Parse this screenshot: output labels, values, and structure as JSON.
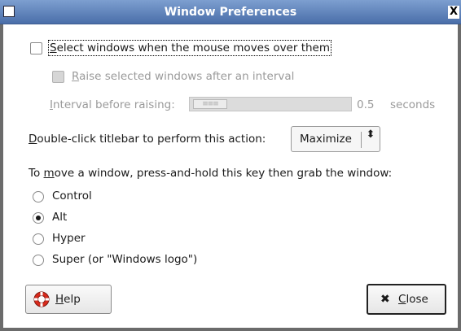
{
  "window": {
    "title": "Window Preferences",
    "close_glyph": "X"
  },
  "focus_option": {
    "label": "Select windows when the mouse moves over them",
    "checked": false
  },
  "raise_option": {
    "label": "Raise selected windows after an interval",
    "checked": false,
    "enabled": false
  },
  "interval": {
    "label": "Interval before raising:",
    "value": "0.5",
    "unit": "seconds",
    "thumb_glyph": "≡≡≡",
    "enabled": false
  },
  "double_click": {
    "label": "Double-click titlebar to perform this action:",
    "selected": "Maximize",
    "arrow_glyph": "⬍"
  },
  "move_modifier": {
    "label": "To move a window, press-and-hold this key then grab the window:",
    "options": [
      {
        "label": "Control",
        "selected": false
      },
      {
        "label": "Alt",
        "selected": true
      },
      {
        "label": "Hyper",
        "selected": false
      },
      {
        "label": "Super (or \"Windows logo\")",
        "selected": false
      }
    ]
  },
  "buttons": {
    "help_label": "Help",
    "close_label": "Close",
    "close_glyph": "✖"
  },
  "colors": {
    "titlebar": "#5b7fb8",
    "frame": "#6b6b6b",
    "help_icon": "#d92a1c"
  },
  "icons": {
    "help": "lifebuoy-icon",
    "close": "x-icon"
  }
}
